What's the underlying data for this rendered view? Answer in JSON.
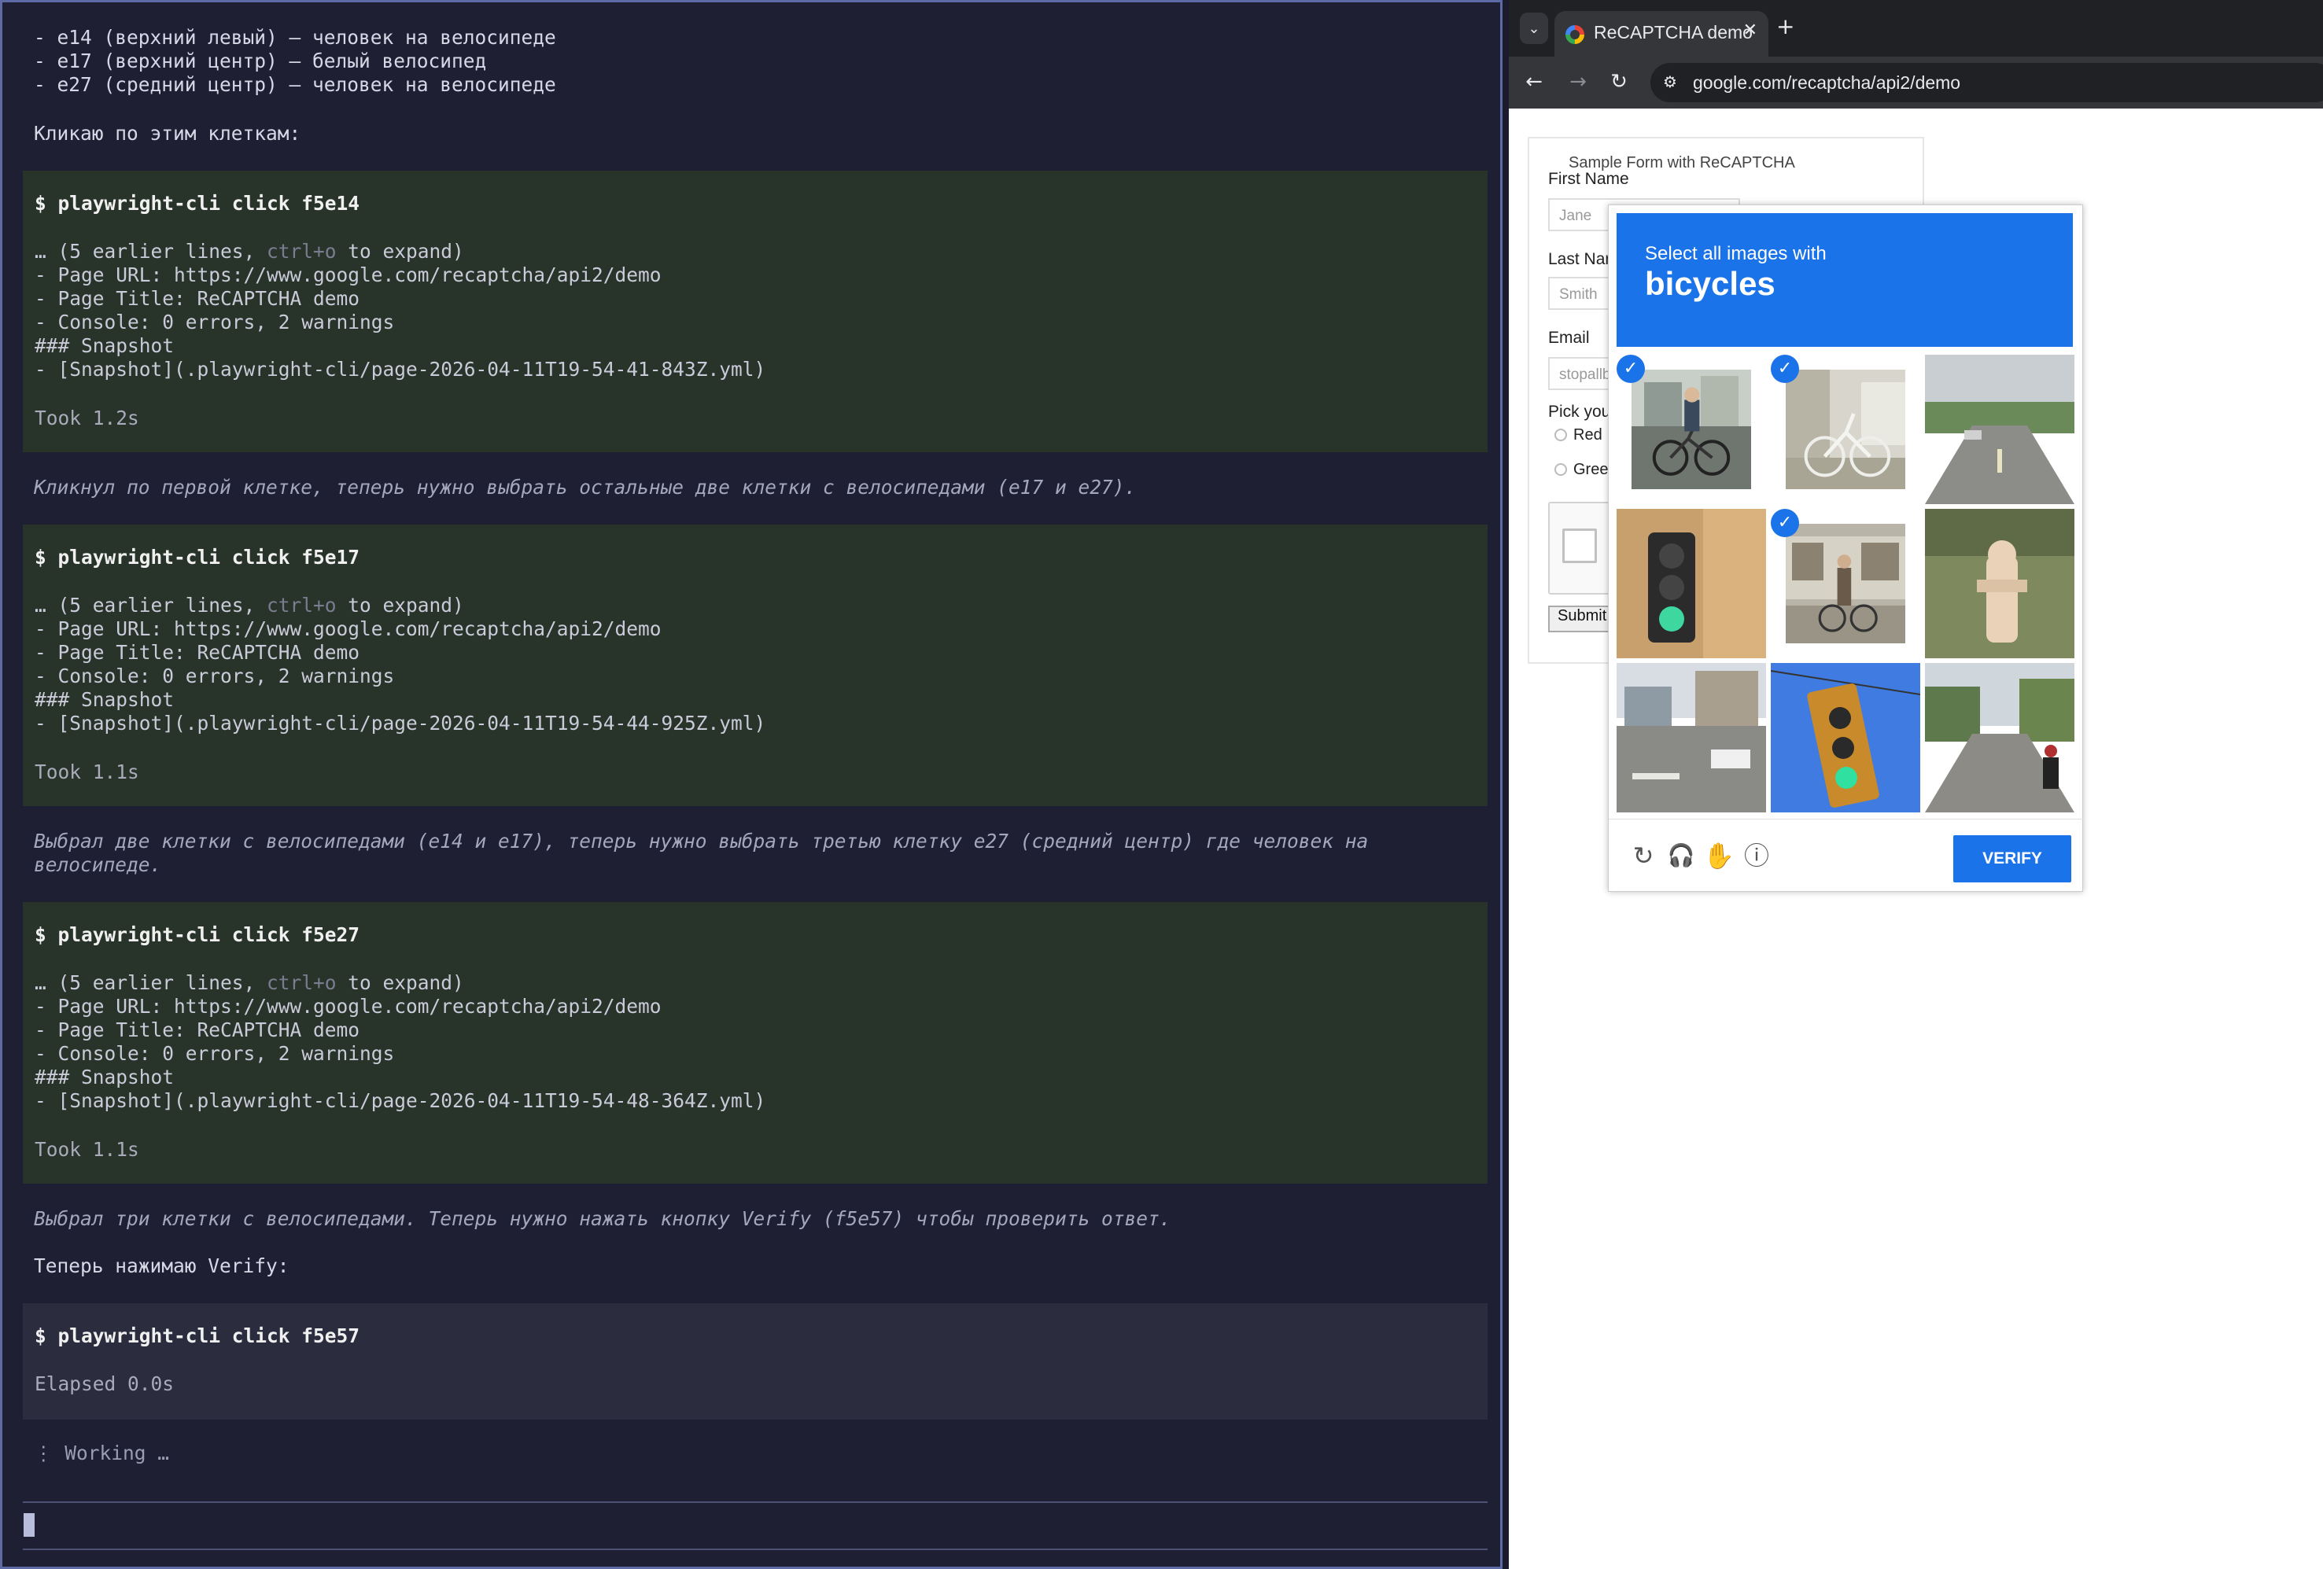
{
  "terminal": {
    "intro_lines": [
      "- e14 (верхний левый) — человек на велосипеде",
      "- e17 (верхний центр) — белый велосипед",
      "- e27 (средний центр) — человек на велосипеде"
    ],
    "intro_action": "Кликаю по этим клеткам:",
    "blocks": [
      {
        "command": "$ playwright-cli click f5e14",
        "collapsed_prefix": "… (5 earlier lines, ",
        "collapsed_hint": "ctrl+o",
        "collapsed_suffix": " to expand)",
        "page_url": "- Page URL: https://www.google.com/recaptcha/api2/demo",
        "page_title": "- Page Title: ReCAPTCHA demo",
        "console": "- Console: 0 errors, 2 warnings",
        "snapshot_heading": "### Snapshot",
        "snapshot_link": "- [Snapshot](.playwright-cli/page-2026-04-11T19-54-41-843Z.yml)",
        "took": "Took 1.2s"
      },
      {
        "command": "$ playwright-cli click f5e17",
        "collapsed_prefix": "… (5 earlier lines, ",
        "collapsed_hint": "ctrl+o",
        "collapsed_suffix": " to expand)",
        "page_url": "- Page URL: https://www.google.com/recaptcha/api2/demo",
        "page_title": "- Page Title: ReCAPTCHA demo",
        "console": "- Console: 0 errors, 2 warnings",
        "snapshot_heading": "### Snapshot",
        "snapshot_link": "- [Snapshot](.playwright-cli/page-2026-04-11T19-54-44-925Z.yml)",
        "took": "Took 1.1s"
      },
      {
        "command": "$ playwright-cli click f5e27",
        "collapsed_prefix": "… (5 earlier lines, ",
        "collapsed_hint": "ctrl+o",
        "collapsed_suffix": " to expand)",
        "page_url": "- Page URL: https://www.google.com/recaptcha/api2/demo",
        "page_title": "- Page Title: ReCAPTCHA demo",
        "console": "- Console: 0 errors, 2 warnings",
        "snapshot_heading": "### Snapshot",
        "snapshot_link": "- [Snapshot](.playwright-cli/page-2026-04-11T19-54-48-364Z.yml)",
        "took": "Took 1.1s"
      }
    ],
    "notes": [
      "Кликнул по первой клетке, теперь нужно выбрать остальные две клетки с велосипедами (e17 и e27).",
      "Выбрал две клетки с велосипедами (e14 и e17), теперь нужно выбрать третью клетку e27 (средний центр) где человек на велосипеде.",
      "Выбрал три клетки с велосипедами. Теперь нужно нажать кнопку Verify (f5e57) чтобы проверить ответ."
    ],
    "verify_action": "Теперь нажимаю Verify:",
    "pending": {
      "command": "$ playwright-cli click f5e57",
      "elapsed": "Elapsed 0.0s"
    },
    "working": "⋮ Working …"
  },
  "browser": {
    "tab_title": "ReCAPTCHA demo",
    "tab_close": "✕",
    "new_tab": "+",
    "tab_list": "⌄",
    "back": "←",
    "forward": "→",
    "reload": "↻",
    "site_info": "⚙",
    "url": "google.com/recaptcha/api2/demo",
    "form": {
      "legend": "Sample Form with ReCAPTCHA",
      "first_name_label": "First Name",
      "first_name_value": "Jane",
      "last_name_label": "Last Nar",
      "last_name_value": "Smith",
      "email_label": "Email",
      "email_value": "stopallb",
      "pick_label": "Pick you",
      "radio_red": "Red",
      "radio_green": "Gree",
      "submit": "Submit"
    },
    "challenge": {
      "prompt": "Select all images with",
      "target": "bicycles",
      "tiles": [
        {
          "id": "tile-1",
          "content": "person-on-bicycle",
          "selected": true
        },
        {
          "id": "tile-2",
          "content": "white-bicycle",
          "selected": true
        },
        {
          "id": "tile-3",
          "content": "road",
          "selected": false
        },
        {
          "id": "tile-4",
          "content": "traffic-light",
          "selected": false
        },
        {
          "id": "tile-5",
          "content": "person-with-bicycle",
          "selected": true
        },
        {
          "id": "tile-6",
          "content": "fire-hydrant",
          "selected": false
        },
        {
          "id": "tile-7",
          "content": "intersection",
          "selected": false
        },
        {
          "id": "tile-8",
          "content": "traffic-light",
          "selected": false
        },
        {
          "id": "tile-9",
          "content": "street-with-motorcycle",
          "selected": false
        }
      ],
      "checkmark": "✓",
      "reload_icon": "↻",
      "audio_icon": "🎧",
      "hand_icon": "✋",
      "info_icon": "ⓘ",
      "verify": "VERIFY"
    }
  }
}
